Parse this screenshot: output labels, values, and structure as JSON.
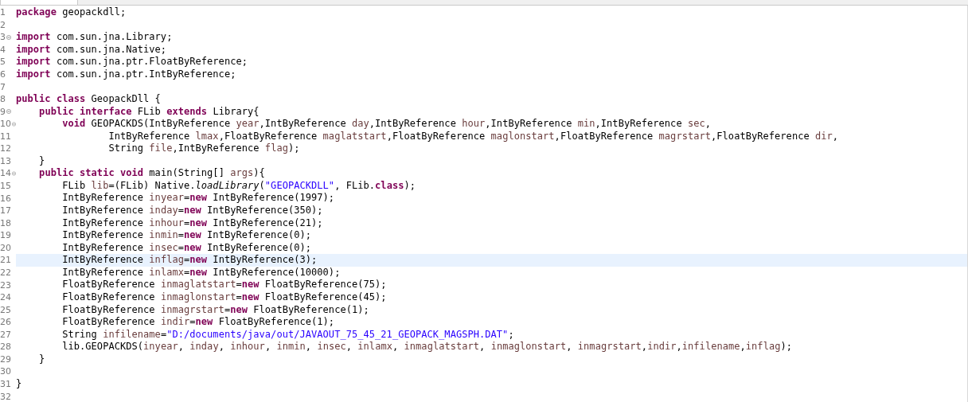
{
  "editor_tab": {
    "selected": true
  },
  "lines": [
    {
      "number": "1",
      "foldable": false,
      "current": false,
      "tokens": [
        {
          "kind": "keyword",
          "text": "package"
        },
        {
          "kind": "plain",
          "text": " geopackdll;"
        }
      ]
    },
    {
      "number": "2",
      "foldable": false,
      "current": false
    },
    {
      "number": "3",
      "foldable": true,
      "current": false,
      "tokens": [
        {
          "kind": "keyword",
          "text": "import"
        },
        {
          "kind": "plain",
          "text": " com.sun.jna.Library;"
        }
      ]
    },
    {
      "number": "4",
      "foldable": false,
      "current": false,
      "tokens": [
        {
          "kind": "keyword",
          "text": "import"
        },
        {
          "kind": "plain",
          "text": " com.sun.jna.Native;"
        }
      ]
    },
    {
      "number": "5",
      "foldable": false,
      "current": false,
      "tokens": [
        {
          "kind": "keyword",
          "text": "import"
        },
        {
          "kind": "plain",
          "text": " com.sun.jna.ptr.FloatByReference;"
        }
      ]
    },
    {
      "number": "6",
      "foldable": false,
      "current": false,
      "tokens": [
        {
          "kind": "keyword",
          "text": "import"
        },
        {
          "kind": "plain",
          "text": " com.sun.jna.ptr.IntByReference;"
        }
      ]
    },
    {
      "number": "7",
      "foldable": false,
      "current": false
    },
    {
      "number": "8",
      "foldable": false,
      "current": false,
      "tokens": [
        {
          "kind": "keyword",
          "text": "public class"
        },
        {
          "kind": "plain",
          "text": " GeopackDll {"
        }
      ]
    },
    {
      "number": "9",
      "foldable": true,
      "current": false,
      "tokens": [
        {
          "kind": "keyword",
          "text": "    public interface"
        },
        {
          "kind": "plain",
          "text": " FLib "
        },
        {
          "kind": "keyword",
          "text": "extends"
        },
        {
          "kind": "plain",
          "text": " Library{"
        }
      ]
    },
    {
      "number": "10",
      "foldable": true,
      "current": false,
      "tokens": [
        {
          "kind": "keyword",
          "text": "        void"
        },
        {
          "kind": "plain",
          "text": " GEOPACKDS(IntByReference "
        },
        {
          "kind": "variable",
          "text": "year"
        },
        {
          "kind": "plain",
          "text": ",IntByReference "
        },
        {
          "kind": "variable",
          "text": "day"
        },
        {
          "kind": "plain",
          "text": ",IntByReference "
        },
        {
          "kind": "variable",
          "text": "hour"
        },
        {
          "kind": "plain",
          "text": ",IntByReference "
        },
        {
          "kind": "variable",
          "text": "min"
        },
        {
          "kind": "plain",
          "text": ",IntByReference "
        },
        {
          "kind": "variable",
          "text": "sec"
        },
        {
          "kind": "plain",
          "text": ","
        }
      ]
    },
    {
      "number": "11",
      "foldable": false,
      "current": false,
      "tokens": [
        {
          "kind": "plain",
          "text": "                IntByReference "
        },
        {
          "kind": "variable",
          "text": "lmax"
        },
        {
          "kind": "plain",
          "text": ",FloatByReference "
        },
        {
          "kind": "variable",
          "text": "maglatstart"
        },
        {
          "kind": "plain",
          "text": ",FloatByReference "
        },
        {
          "kind": "variable",
          "text": "maglonstart"
        },
        {
          "kind": "plain",
          "text": ",FloatByReference "
        },
        {
          "kind": "variable",
          "text": "magrstart"
        },
        {
          "kind": "plain",
          "text": ",FloatByReference "
        },
        {
          "kind": "variable",
          "text": "dir"
        },
        {
          "kind": "plain",
          "text": ","
        }
      ]
    },
    {
      "number": "12",
      "foldable": false,
      "current": false,
      "tokens": [
        {
          "kind": "plain",
          "text": "                String "
        },
        {
          "kind": "variable",
          "text": "file"
        },
        {
          "kind": "plain",
          "text": ",IntByReference "
        },
        {
          "kind": "variable",
          "text": "flag"
        },
        {
          "kind": "plain",
          "text": ");"
        }
      ]
    },
    {
      "number": "13",
      "foldable": false,
      "current": false,
      "tokens": [
        {
          "kind": "plain",
          "text": "    }"
        }
      ]
    },
    {
      "number": "14",
      "foldable": true,
      "current": false,
      "tokens": [
        {
          "kind": "keyword",
          "text": "    public static void"
        },
        {
          "kind": "plain",
          "text": " main(String[] "
        },
        {
          "kind": "variable",
          "text": "args"
        },
        {
          "kind": "plain",
          "text": "){"
        }
      ]
    },
    {
      "number": "15",
      "foldable": false,
      "current": false,
      "tokens": [
        {
          "kind": "plain",
          "text": "        FLib "
        },
        {
          "kind": "variable",
          "text": "lib"
        },
        {
          "kind": "plain",
          "text": "=(FLib) Native."
        },
        {
          "kind": "italic",
          "text": "loadLibrary"
        },
        {
          "kind": "plain",
          "text": "("
        },
        {
          "kind": "string",
          "text": "\"GEOPACKDLL\""
        },
        {
          "kind": "plain",
          "text": ", FLib."
        },
        {
          "kind": "keyword",
          "text": "class"
        },
        {
          "kind": "plain",
          "text": ");"
        }
      ]
    },
    {
      "number": "16",
      "foldable": false,
      "current": false,
      "tokens": [
        {
          "kind": "plain",
          "text": "        IntByReference "
        },
        {
          "kind": "variable",
          "text": "inyear"
        },
        {
          "kind": "plain",
          "text": "="
        },
        {
          "kind": "keyword",
          "text": "new"
        },
        {
          "kind": "plain",
          "text": " IntByReference(1997);"
        }
      ]
    },
    {
      "number": "17",
      "foldable": false,
      "current": false,
      "tokens": [
        {
          "kind": "plain",
          "text": "        IntByReference "
        },
        {
          "kind": "variable",
          "text": "inday"
        },
        {
          "kind": "plain",
          "text": "="
        },
        {
          "kind": "keyword",
          "text": "new"
        },
        {
          "kind": "plain",
          "text": " IntByReference(350);"
        }
      ]
    },
    {
      "number": "18",
      "foldable": false,
      "current": false,
      "tokens": [
        {
          "kind": "plain",
          "text": "        IntByReference "
        },
        {
          "kind": "variable",
          "text": "inhour"
        },
        {
          "kind": "plain",
          "text": "="
        },
        {
          "kind": "keyword",
          "text": "new"
        },
        {
          "kind": "plain",
          "text": " IntByReference(21);"
        }
      ]
    },
    {
      "number": "19",
      "foldable": false,
      "current": false,
      "tokens": [
        {
          "kind": "plain",
          "text": "        IntByReference "
        },
        {
          "kind": "variable",
          "text": "inmin"
        },
        {
          "kind": "plain",
          "text": "="
        },
        {
          "kind": "keyword",
          "text": "new"
        },
        {
          "kind": "plain",
          "text": " IntByReference(0);"
        }
      ]
    },
    {
      "number": "20",
      "foldable": false,
      "current": false,
      "tokens": [
        {
          "kind": "plain",
          "text": "        IntByReference "
        },
        {
          "kind": "variable",
          "text": "insec"
        },
        {
          "kind": "plain",
          "text": "="
        },
        {
          "kind": "keyword",
          "text": "new"
        },
        {
          "kind": "plain",
          "text": " IntByReference(0);"
        }
      ]
    },
    {
      "number": "21",
      "foldable": false,
      "current": true,
      "tokens": [
        {
          "kind": "plain",
          "text": "        IntByReference "
        },
        {
          "kind": "variable",
          "text": "inflag"
        },
        {
          "kind": "plain",
          "text": "="
        },
        {
          "kind": "keyword",
          "text": "new"
        },
        {
          "kind": "plain",
          "text": " IntByReference(3);"
        }
      ]
    },
    {
      "number": "22",
      "foldable": false,
      "current": false,
      "tokens": [
        {
          "kind": "plain",
          "text": "        IntByReference "
        },
        {
          "kind": "variable",
          "text": "inlamx"
        },
        {
          "kind": "plain",
          "text": "="
        },
        {
          "kind": "keyword",
          "text": "new"
        },
        {
          "kind": "plain",
          "text": " IntByReference(10000);"
        }
      ]
    },
    {
      "number": "23",
      "foldable": false,
      "current": false,
      "tokens": [
        {
          "kind": "plain",
          "text": "        FloatByReference "
        },
        {
          "kind": "variable",
          "text": "inmaglatstart"
        },
        {
          "kind": "plain",
          "text": "="
        },
        {
          "kind": "keyword",
          "text": "new"
        },
        {
          "kind": "plain",
          "text": " FloatByReference(75);"
        }
      ]
    },
    {
      "number": "24",
      "foldable": false,
      "current": false,
      "tokens": [
        {
          "kind": "plain",
          "text": "        FloatByReference "
        },
        {
          "kind": "variable",
          "text": "inmaglonstart"
        },
        {
          "kind": "plain",
          "text": "="
        },
        {
          "kind": "keyword",
          "text": "new"
        },
        {
          "kind": "plain",
          "text": " FloatByReference(45);"
        }
      ]
    },
    {
      "number": "25",
      "foldable": false,
      "current": false,
      "tokens": [
        {
          "kind": "plain",
          "text": "        FloatByReference "
        },
        {
          "kind": "variable",
          "text": "inmagrstart"
        },
        {
          "kind": "plain",
          "text": "="
        },
        {
          "kind": "keyword",
          "text": "new"
        },
        {
          "kind": "plain",
          "text": " FloatByReference(1);"
        }
      ]
    },
    {
      "number": "26",
      "foldable": false,
      "current": false,
      "tokens": [
        {
          "kind": "plain",
          "text": "        FloatByReference "
        },
        {
          "kind": "variable",
          "text": "indir"
        },
        {
          "kind": "plain",
          "text": "="
        },
        {
          "kind": "keyword",
          "text": "new"
        },
        {
          "kind": "plain",
          "text": " FloatByReference(1);"
        }
      ]
    },
    {
      "number": "27",
      "foldable": false,
      "current": false,
      "tokens": [
        {
          "kind": "plain",
          "text": "        String "
        },
        {
          "kind": "variable",
          "text": "infilename"
        },
        {
          "kind": "plain",
          "text": "="
        },
        {
          "kind": "string",
          "text": "\"D:/documents/java/out/JAVAOUT_75_45_21_GEOPACK_MAGSPH.DAT\""
        },
        {
          "kind": "plain",
          "text": ";"
        }
      ]
    },
    {
      "number": "28",
      "foldable": false,
      "current": false,
      "tokens": [
        {
          "kind": "plain",
          "text": "        lib.GEOPACKDS("
        },
        {
          "kind": "variable",
          "text": "inyear"
        },
        {
          "kind": "plain",
          "text": ", "
        },
        {
          "kind": "variable",
          "text": "inday"
        },
        {
          "kind": "plain",
          "text": ", "
        },
        {
          "kind": "variable",
          "text": "inhour"
        },
        {
          "kind": "plain",
          "text": ", "
        },
        {
          "kind": "variable",
          "text": "inmin"
        },
        {
          "kind": "plain",
          "text": ", "
        },
        {
          "kind": "variable",
          "text": "insec"
        },
        {
          "kind": "plain",
          "text": ", "
        },
        {
          "kind": "variable",
          "text": "inlamx"
        },
        {
          "kind": "plain",
          "text": ", "
        },
        {
          "kind": "variable",
          "text": "inmaglatstart"
        },
        {
          "kind": "plain",
          "text": ", "
        },
        {
          "kind": "variable",
          "text": "inmaglonstart"
        },
        {
          "kind": "plain",
          "text": ", "
        },
        {
          "kind": "variable",
          "text": "inmagrstart"
        },
        {
          "kind": "plain",
          "text": ","
        },
        {
          "kind": "variable",
          "text": "indir"
        },
        {
          "kind": "plain",
          "text": ","
        },
        {
          "kind": "variable",
          "text": "infilename"
        },
        {
          "kind": "plain",
          "text": ","
        },
        {
          "kind": "variable",
          "text": "inflag"
        },
        {
          "kind": "plain",
          "text": ");"
        }
      ]
    },
    {
      "number": "29",
      "foldable": false,
      "current": false,
      "tokens": [
        {
          "kind": "plain",
          "text": "    }"
        }
      ]
    },
    {
      "number": "30",
      "foldable": false,
      "current": false
    },
    {
      "number": "31",
      "foldable": false,
      "current": false,
      "tokens": [
        {
          "kind": "plain",
          "text": "}"
        }
      ]
    },
    {
      "number": "32",
      "foldable": false,
      "current": false
    }
  ]
}
